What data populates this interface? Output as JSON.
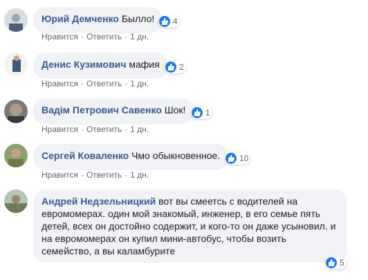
{
  "actions": {
    "like": "Нравится",
    "reply": "Ответить",
    "sep": "·",
    "time": "1 дн."
  },
  "comments": [
    {
      "author": "Юрий Демченко",
      "text": "Былло!",
      "likes": "4"
    },
    {
      "author": "Денис Кузимович",
      "text": "мафия",
      "likes": "2"
    },
    {
      "author": "Вадім Петрович Савенко",
      "text": "Шок!",
      "likes": "1"
    },
    {
      "author": "Сергей Коваленко",
      "text": "Чмо обыкновенное.",
      "likes": "10"
    },
    {
      "author": "Андрей Недзельницкий",
      "text": "вот вы смеетсь с водителей на евромомерах. один мой знакомый, инженер, в его семье пять детей, всех он достойно содержит, и кого-то он даже усыновил. и на евромомерах он купил мини-автобус, чтобы возить семейство, а вы каламбурите",
      "likes": "5"
    }
  ]
}
